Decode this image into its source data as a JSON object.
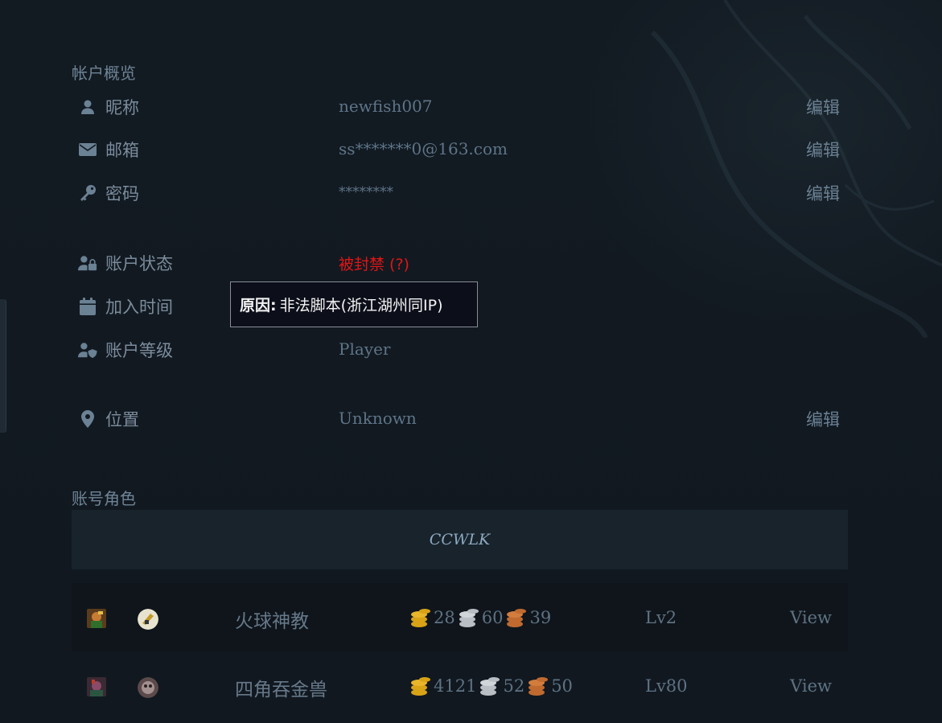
{
  "overview": {
    "title": "帐户概览",
    "rows": [
      {
        "icon": "user-icon",
        "label": "昵称",
        "value": "newfish007",
        "edit": "编辑"
      },
      {
        "icon": "envelope-icon",
        "label": "邮箱",
        "value": "ss*******0@163.com",
        "edit": "编辑"
      },
      {
        "icon": "key-icon",
        "label": "密码",
        "value": "********",
        "edit": "编辑"
      }
    ],
    "status": {
      "icon": "user-lock-icon",
      "label": "账户状态",
      "value": "被封禁 (?)"
    },
    "joined": {
      "icon": "calendar-icon",
      "label": "加入时间"
    },
    "level": {
      "icon": "user-shield-icon",
      "label": "账户等级",
      "value": "Player"
    },
    "location": {
      "icon": "map-marker-icon",
      "label": "位置",
      "value": "Unknown",
      "edit": "编辑"
    }
  },
  "tooltip": {
    "reason_label": "原因:",
    "reason_text": "非法脚本(浙江湖州同IP)"
  },
  "characters": {
    "title": "账号角色",
    "realm": "CCWLK",
    "rows": [
      {
        "name": "火球神教",
        "gold": "28",
        "silver": "60",
        "copper": "39",
        "level": "Lv2",
        "view": "View"
      },
      {
        "name": "四角吞金兽",
        "gold": "4121",
        "silver": "52",
        "copper": "50",
        "level": "Lv80",
        "view": "View"
      }
    ]
  },
  "colors": {
    "banned": "#e01515",
    "gold": "#d9a317",
    "silver": "#b8bec4",
    "copper": "#c06a30"
  }
}
